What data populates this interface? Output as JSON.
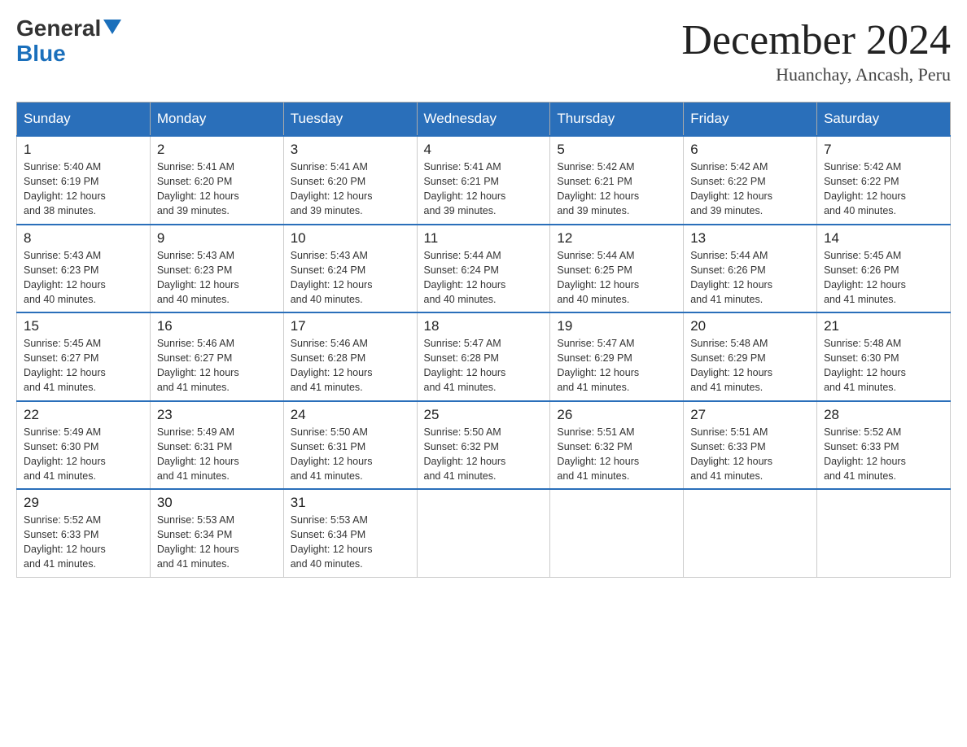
{
  "header": {
    "logo_general": "General",
    "logo_blue": "Blue",
    "title": "December 2024",
    "subtitle": "Huanchay, Ancash, Peru"
  },
  "calendar": {
    "headers": [
      "Sunday",
      "Monday",
      "Tuesday",
      "Wednesday",
      "Thursday",
      "Friday",
      "Saturday"
    ],
    "weeks": [
      [
        {
          "day": "1",
          "sunrise": "5:40 AM",
          "sunset": "6:19 PM",
          "daylight": "12 hours and 38 minutes."
        },
        {
          "day": "2",
          "sunrise": "5:41 AM",
          "sunset": "6:20 PM",
          "daylight": "12 hours and 39 minutes."
        },
        {
          "day": "3",
          "sunrise": "5:41 AM",
          "sunset": "6:20 PM",
          "daylight": "12 hours and 39 minutes."
        },
        {
          "day": "4",
          "sunrise": "5:41 AM",
          "sunset": "6:21 PM",
          "daylight": "12 hours and 39 minutes."
        },
        {
          "day": "5",
          "sunrise": "5:42 AM",
          "sunset": "6:21 PM",
          "daylight": "12 hours and 39 minutes."
        },
        {
          "day": "6",
          "sunrise": "5:42 AM",
          "sunset": "6:22 PM",
          "daylight": "12 hours and 39 minutes."
        },
        {
          "day": "7",
          "sunrise": "5:42 AM",
          "sunset": "6:22 PM",
          "daylight": "12 hours and 40 minutes."
        }
      ],
      [
        {
          "day": "8",
          "sunrise": "5:43 AM",
          "sunset": "6:23 PM",
          "daylight": "12 hours and 40 minutes."
        },
        {
          "day": "9",
          "sunrise": "5:43 AM",
          "sunset": "6:23 PM",
          "daylight": "12 hours and 40 minutes."
        },
        {
          "day": "10",
          "sunrise": "5:43 AM",
          "sunset": "6:24 PM",
          "daylight": "12 hours and 40 minutes."
        },
        {
          "day": "11",
          "sunrise": "5:44 AM",
          "sunset": "6:24 PM",
          "daylight": "12 hours and 40 minutes."
        },
        {
          "day": "12",
          "sunrise": "5:44 AM",
          "sunset": "6:25 PM",
          "daylight": "12 hours and 40 minutes."
        },
        {
          "day": "13",
          "sunrise": "5:44 AM",
          "sunset": "6:26 PM",
          "daylight": "12 hours and 41 minutes."
        },
        {
          "day": "14",
          "sunrise": "5:45 AM",
          "sunset": "6:26 PM",
          "daylight": "12 hours and 41 minutes."
        }
      ],
      [
        {
          "day": "15",
          "sunrise": "5:45 AM",
          "sunset": "6:27 PM",
          "daylight": "12 hours and 41 minutes."
        },
        {
          "day": "16",
          "sunrise": "5:46 AM",
          "sunset": "6:27 PM",
          "daylight": "12 hours and 41 minutes."
        },
        {
          "day": "17",
          "sunrise": "5:46 AM",
          "sunset": "6:28 PM",
          "daylight": "12 hours and 41 minutes."
        },
        {
          "day": "18",
          "sunrise": "5:47 AM",
          "sunset": "6:28 PM",
          "daylight": "12 hours and 41 minutes."
        },
        {
          "day": "19",
          "sunrise": "5:47 AM",
          "sunset": "6:29 PM",
          "daylight": "12 hours and 41 minutes."
        },
        {
          "day": "20",
          "sunrise": "5:48 AM",
          "sunset": "6:29 PM",
          "daylight": "12 hours and 41 minutes."
        },
        {
          "day": "21",
          "sunrise": "5:48 AM",
          "sunset": "6:30 PM",
          "daylight": "12 hours and 41 minutes."
        }
      ],
      [
        {
          "day": "22",
          "sunrise": "5:49 AM",
          "sunset": "6:30 PM",
          "daylight": "12 hours and 41 minutes."
        },
        {
          "day": "23",
          "sunrise": "5:49 AM",
          "sunset": "6:31 PM",
          "daylight": "12 hours and 41 minutes."
        },
        {
          "day": "24",
          "sunrise": "5:50 AM",
          "sunset": "6:31 PM",
          "daylight": "12 hours and 41 minutes."
        },
        {
          "day": "25",
          "sunrise": "5:50 AM",
          "sunset": "6:32 PM",
          "daylight": "12 hours and 41 minutes."
        },
        {
          "day": "26",
          "sunrise": "5:51 AM",
          "sunset": "6:32 PM",
          "daylight": "12 hours and 41 minutes."
        },
        {
          "day": "27",
          "sunrise": "5:51 AM",
          "sunset": "6:33 PM",
          "daylight": "12 hours and 41 minutes."
        },
        {
          "day": "28",
          "sunrise": "5:52 AM",
          "sunset": "6:33 PM",
          "daylight": "12 hours and 41 minutes."
        }
      ],
      [
        {
          "day": "29",
          "sunrise": "5:52 AM",
          "sunset": "6:33 PM",
          "daylight": "12 hours and 41 minutes."
        },
        {
          "day": "30",
          "sunrise": "5:53 AM",
          "sunset": "6:34 PM",
          "daylight": "12 hours and 41 minutes."
        },
        {
          "day": "31",
          "sunrise": "5:53 AM",
          "sunset": "6:34 PM",
          "daylight": "12 hours and 40 minutes."
        },
        null,
        null,
        null,
        null
      ]
    ],
    "labels": {
      "sunrise": "Sunrise:",
      "sunset": "Sunset:",
      "daylight": "Daylight:"
    }
  }
}
